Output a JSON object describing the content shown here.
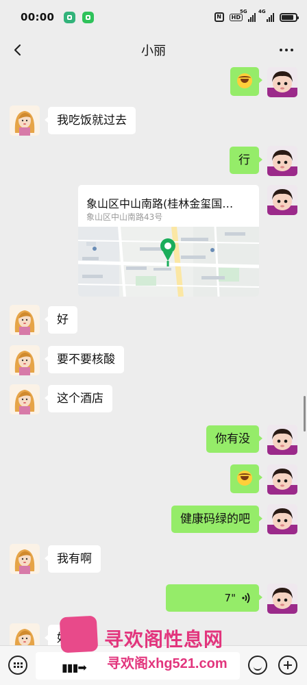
{
  "status": {
    "time": "00:00",
    "network_label": "5G",
    "network_label_2": "4G",
    "hd_label": "HD"
  },
  "header": {
    "title": "小丽"
  },
  "messages": [
    {
      "from": "me",
      "type": "emoji",
      "icon": "laughing-crying-emoji"
    },
    {
      "from": "her",
      "type": "text",
      "text": "我吃饭就过去"
    },
    {
      "from": "me",
      "type": "text",
      "text": "行"
    },
    {
      "from": "me",
      "type": "location",
      "title": "象山区中山南路(桂林金玺国…",
      "address": "象山区中山南路43号"
    },
    {
      "from": "her",
      "type": "text",
      "text": "好"
    },
    {
      "from": "her",
      "type": "text",
      "text": "要不要核酸"
    },
    {
      "from": "her",
      "type": "text",
      "text": "这个酒店"
    },
    {
      "from": "me",
      "type": "text",
      "text": "你有没"
    },
    {
      "from": "me",
      "type": "emoji",
      "icon": "laughing-crying-emoji"
    },
    {
      "from": "me",
      "type": "text",
      "text": "健康码绿的吧"
    },
    {
      "from": "her",
      "type": "text",
      "text": "我有啊"
    },
    {
      "from": "me",
      "type": "voice",
      "duration": "7\""
    },
    {
      "from": "her",
      "type": "text",
      "text": "好"
    }
  ],
  "input": {
    "placeholder": ""
  },
  "watermark": {
    "line1": "寻欢阁性息网",
    "line2": "xhg521.com",
    "line2_prefix": "寻欢阁"
  },
  "colors": {
    "my_bubble": "#95ec69",
    "her_bubble": "#ffffff",
    "background": "#ededed",
    "location_pin": "#1aad5a"
  }
}
